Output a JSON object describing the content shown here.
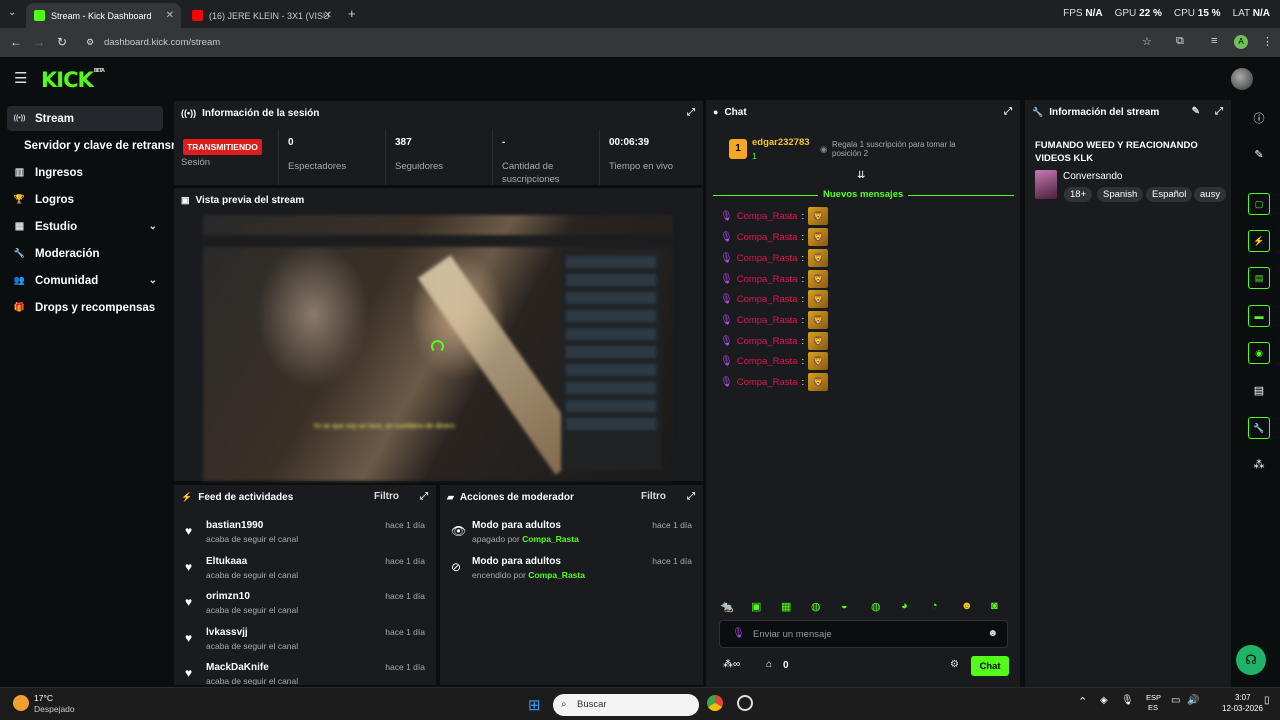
{
  "browser": {
    "tabs": [
      {
        "title": "Stream - Kick Dashboard",
        "active": true,
        "favicon_color": "#53fc18"
      },
      {
        "title": "(16) JERE KLEIN - 3X1 (VISU",
        "active": false,
        "favicon_color": "#ff0000"
      }
    ],
    "stats": {
      "fps_label": "FPS",
      "fps": "N/A",
      "gpu_label": "GPU",
      "gpu": "22 %",
      "cpu_label": "CPU",
      "cpu": "15 %",
      "lat_label": "LAT",
      "lat": "N/A"
    },
    "url": "dashboard.kick.com/stream"
  },
  "logo": {
    "text": "KICK",
    "sup": "BETA"
  },
  "sidebar": {
    "items": [
      {
        "label": "Stream",
        "icon": "broadcast-icon",
        "glyph": "((•))",
        "active": true,
        "chevron": false
      },
      {
        "label": "Servidor y clave de retransm",
        "icon": "",
        "glyph": "",
        "active": false,
        "chevron": false
      },
      {
        "label": "Ingresos",
        "icon": "chart-icon",
        "glyph": "▥",
        "active": false,
        "chevron": false
      },
      {
        "label": "Logros",
        "icon": "trophy-icon",
        "glyph": "🏆",
        "active": false,
        "chevron": false
      },
      {
        "label": "Estudio",
        "icon": "grid-icon",
        "glyph": "▦",
        "active": false,
        "chevron": true
      },
      {
        "label": "Moderación",
        "icon": "wrench-icon",
        "glyph": "🔧",
        "active": false,
        "chevron": false
      },
      {
        "label": "Comunidad",
        "icon": "users-icon",
        "glyph": "👥",
        "active": false,
        "chevron": true
      },
      {
        "label": "Drops y recompensas",
        "icon": "gift-icon",
        "glyph": "🎁",
        "active": false,
        "chevron": false
      }
    ]
  },
  "session": {
    "title": "Información de la sesión",
    "badge": "TRANSMITIENDO",
    "badge_label": "Sesión",
    "stats": [
      {
        "value": "0",
        "label": "Espectadores"
      },
      {
        "value": "387",
        "label": "Seguidores"
      },
      {
        "value": "-",
        "label": "Cantidad de suscripciones"
      },
      {
        "value": "00:06:39",
        "label": "Tiempo en vivo"
      }
    ]
  },
  "preview": {
    "title": "Vista previa del stream",
    "caption": "Yo se que soy un loco, un cumbiero de dinero"
  },
  "activity": {
    "title": "Feed de actividades",
    "filter": "Filtro",
    "items": [
      {
        "name": "bastian1990",
        "desc": "acaba de seguir el canal",
        "time": "hace 1 día"
      },
      {
        "name": "Eltukaaa",
        "desc": "acaba de seguir el canal",
        "time": "hace 1 día"
      },
      {
        "name": "orimzn10",
        "desc": "acaba de seguir el canal",
        "time": "hace 1 día"
      },
      {
        "name": "lvkassvjj",
        "desc": "acaba de seguir el canal",
        "time": "hace 1 día"
      },
      {
        "name": "MackDaKnife",
        "desc": "acaba de seguir el canal",
        "time": "hace 1 día"
      }
    ]
  },
  "modactions": {
    "title": "Acciones de moderador",
    "filter": "Filtro",
    "items": [
      {
        "name": "Modo para adultos",
        "desc": "apagado por",
        "user": "Compa_Rasta",
        "time": "hace 1 día"
      },
      {
        "name": "Modo para adultos",
        "desc": "encendido por",
        "user": "Compa_Rasta",
        "time": "hace 1 día"
      }
    ]
  },
  "chat": {
    "title": "Chat",
    "pinned": {
      "rank": "1",
      "user": "edgar232783",
      "count": "1",
      "text": "Regala 1 suscripción para tomar la posición 2"
    },
    "new_messages": "Nuevos mensajes",
    "messages": [
      {
        "user": "Compa_Rasta",
        "sep": ":"
      },
      {
        "user": "Compa_Rasta",
        "sep": ":"
      },
      {
        "user": "Compa_Rasta",
        "sep": ":"
      },
      {
        "user": "Compa_Rasta",
        "sep": ":"
      },
      {
        "user": "Compa_Rasta",
        "sep": ":"
      },
      {
        "user": "Compa_Rasta",
        "sep": ":"
      },
      {
        "user": "Compa_Rasta",
        "sep": ":"
      },
      {
        "user": "Compa_Rasta",
        "sep": ":"
      },
      {
        "user": "Compa_Rasta",
        "sep": ":"
      }
    ],
    "placeholder": "Enviar un mensaje",
    "viewers": "0",
    "send": "Chat"
  },
  "stream_info": {
    "title": "Información del stream",
    "stream_title": "FUMANDO WEED Y REACIONANDO VIDEOS KLK",
    "category": "Conversando",
    "tags": [
      "18+",
      "Spanish",
      "Español",
      "ausy"
    ]
  },
  "taskbar": {
    "weather_temp": "17°C",
    "weather_desc": "Despejado",
    "search": "Buscar",
    "lang1": "ESP",
    "lang2": "ES",
    "time": "3:07",
    "date": "12-03-2026"
  }
}
